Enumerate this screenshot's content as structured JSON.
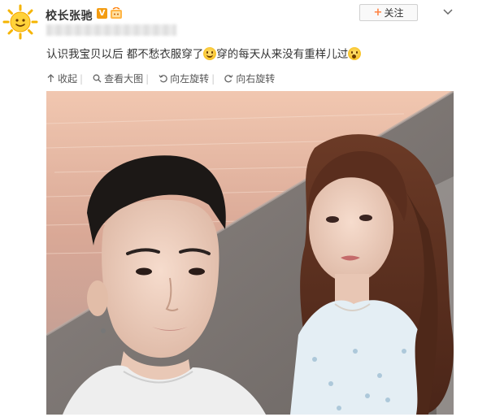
{
  "user": {
    "name": "校长张驰",
    "verified_badge": "V",
    "avatar_icon": "sun-avatar",
    "level_icon": "vip-level-icon"
  },
  "follow_button": {
    "plus": "+",
    "label": "关注"
  },
  "post": {
    "text_part1": "认识我宝贝以后 都不愁衣服穿了",
    "text_part2": "穿的每天从来没有重样儿过"
  },
  "toolbar": {
    "items": [
      {
        "label": "收起",
        "icon": "collapse-icon"
      },
      {
        "label": "查看大图",
        "icon": "search-icon"
      },
      {
        "label": "向左旋转",
        "icon": "rotate-left-icon"
      },
      {
        "label": "向右旋转",
        "icon": "rotate-right-icon"
      }
    ]
  },
  "colors": {
    "accent": "#ff8140",
    "badge": "#f39c12",
    "text": "#333333"
  }
}
